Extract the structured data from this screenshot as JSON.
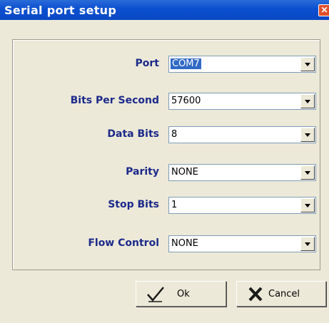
{
  "window": {
    "title": "Serial port setup"
  },
  "fields": [
    {
      "label": "Port",
      "value": "COM7"
    },
    {
      "label": "Bits Per Second",
      "value": "57600"
    },
    {
      "label": "Data Bits",
      "value": "8"
    },
    {
      "label": "Parity",
      "value": "NONE"
    },
    {
      "label": "Stop Bits",
      "value": "1"
    },
    {
      "label": "Flow Control",
      "value": "NONE"
    }
  ],
  "buttons": {
    "ok_label": "Ok",
    "cancel_label": "Cancel"
  },
  "colors": {
    "title_bar": "#0b4fd0",
    "label_text": "#1c2a8a",
    "selection": "#316ac5"
  },
  "icons": {
    "close": "close-icon",
    "ok": "check-icon",
    "cancel": "x-cross-icon",
    "dropdown": "chevron-down-icon"
  }
}
